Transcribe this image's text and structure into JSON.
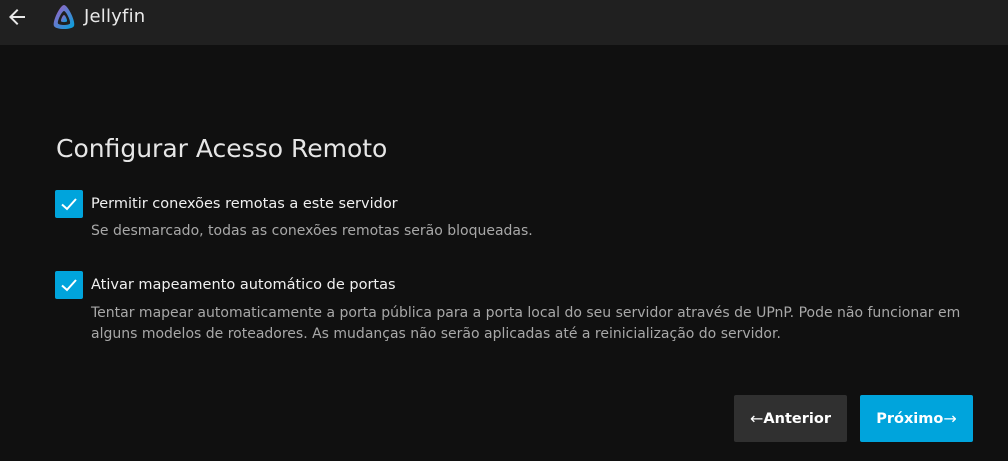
{
  "header": {
    "brand": "Jellyfin"
  },
  "page": {
    "title": "Configurar Acesso Remoto"
  },
  "options": [
    {
      "label": "Permitir conexões remotas a este servidor",
      "description": "Se desmarcado, todas as conexões remotas serão bloqueadas.",
      "checked": true
    },
    {
      "label": "Ativar mapeamento automático de portas",
      "description": "Tentar mapear automaticamente a porta pública para a porta local do seu servidor através de UPnP. Pode não funcionar em alguns modelos de roteadores. As mudanças não serão aplicadas até a reinicialização do servidor.",
      "checked": true
    }
  ],
  "buttons": {
    "previous": "Anterior",
    "next": "Próximo"
  },
  "colors": {
    "accent": "#00a4dc",
    "header_bg": "#202020",
    "page_bg": "#101010",
    "secondary_button": "#303030"
  },
  "icons": {
    "back": "arrow-left-icon",
    "logo": "jellyfin-logo-icon",
    "check": "check-icon",
    "prev_arrow": "arrow-left-icon",
    "next_arrow": "arrow-right-icon"
  }
}
